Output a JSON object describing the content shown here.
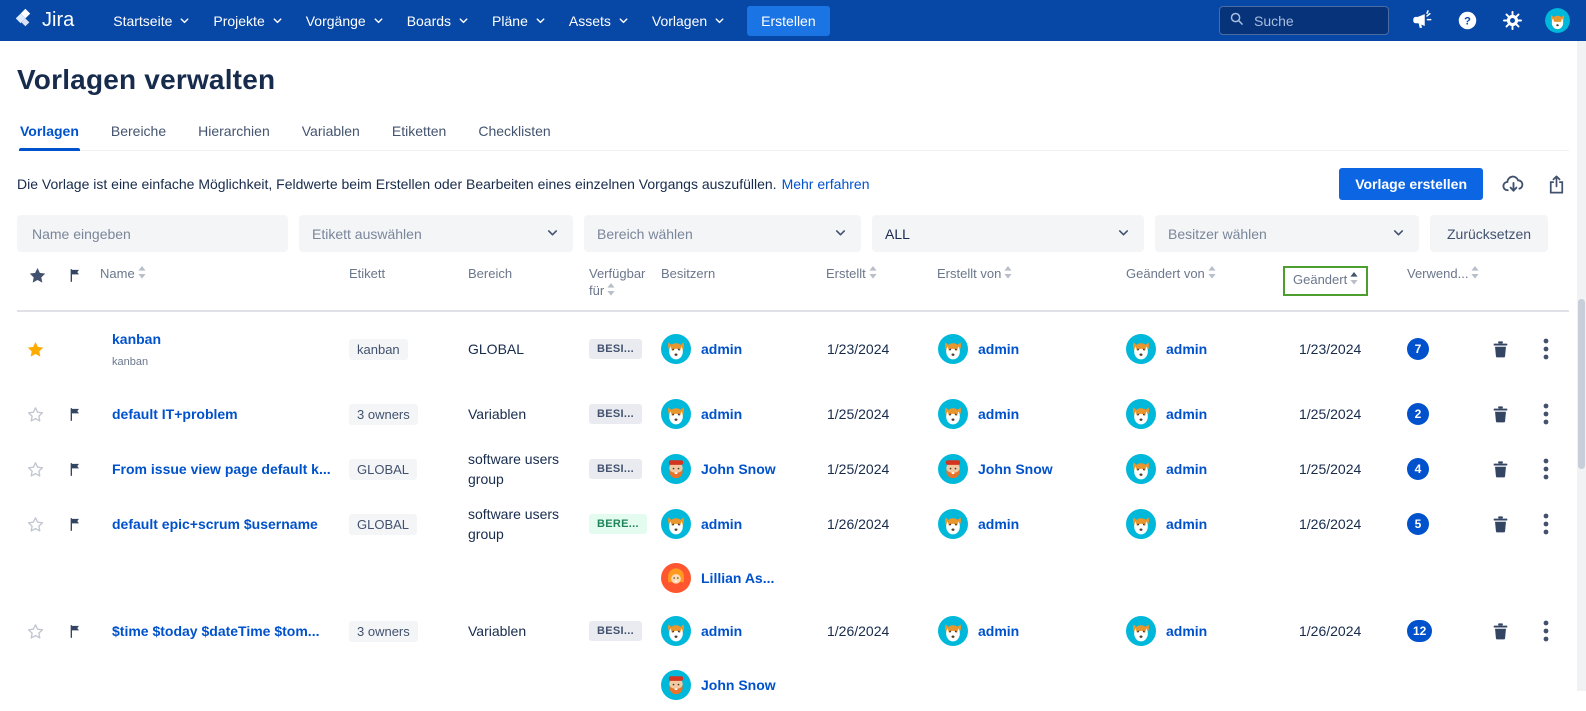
{
  "navbar": {
    "logo_text": "Jira",
    "items": [
      "Startseite",
      "Projekte",
      "Vorgänge",
      "Boards",
      "Pläne",
      "Assets",
      "Vorlagen"
    ],
    "create_label": "Erstellen",
    "search_placeholder": "Suche"
  },
  "page": {
    "title": "Vorlagen verwalten"
  },
  "tabs": {
    "items": [
      "Vorlagen",
      "Bereiche",
      "Hierarchien",
      "Variablen",
      "Etiketten",
      "Checklisten"
    ],
    "active": "Vorlagen"
  },
  "intro": {
    "text": "Die Vorlage ist eine einfache Möglichkeit, Feldwerte beim Erstellen oder Bearbeiten eines einzelnen Vorgangs auszufüllen.",
    "link_label": "Mehr erfahren"
  },
  "toolbar": {
    "create_label": "Vorlage erstellen"
  },
  "filters": {
    "name_placeholder": "Name eingeben",
    "label_placeholder": "Etikett auswählen",
    "scope_placeholder": "Bereich wählen",
    "type_value": "ALL",
    "owner_placeholder": "Besitzer wählen",
    "reset_label": "Zurücksetzen"
  },
  "table": {
    "headers": {
      "name": "Name",
      "label": "Etikett",
      "scope": "Bereich",
      "available_for": "Verfügbar für",
      "owners": "Besitzern",
      "created": "Erstellt",
      "created_by": "Erstellt von",
      "modified_by": "Geändert von",
      "modified": "Geändert",
      "usage": "Verwend..."
    },
    "sort": {
      "column": "Geändert",
      "direction": "asc",
      "highlight_color": "#4C9F2F"
    },
    "rows": [
      {
        "starred": true,
        "flagged": false,
        "name": "kanban",
        "subtitle": "kanban",
        "label": "kanban",
        "scope": "GLOBAL",
        "availability": {
          "text": "BESI...",
          "variant": "gray"
        },
        "owners": [
          {
            "name": "admin",
            "avatar": "dog"
          }
        ],
        "created": "1/23/2024",
        "created_by": {
          "name": "admin",
          "avatar": "dog"
        },
        "modified_by": {
          "name": "admin",
          "avatar": "dog"
        },
        "modified": "1/23/2024",
        "usage": "7"
      },
      {
        "starred": false,
        "flagged": true,
        "name": "default IT+problem",
        "subtitle": "",
        "label": "3 owners",
        "scope": "Variablen",
        "availability": {
          "text": "BESI...",
          "variant": "gray"
        },
        "owners": [
          {
            "name": "admin",
            "avatar": "dog"
          }
        ],
        "created": "1/25/2024",
        "created_by": {
          "name": "admin",
          "avatar": "dog"
        },
        "modified_by": {
          "name": "admin",
          "avatar": "dog"
        },
        "modified": "1/25/2024",
        "usage": "2"
      },
      {
        "starred": false,
        "flagged": true,
        "name": "From issue view page default k...",
        "subtitle": "",
        "label": "GLOBAL",
        "scope": "software users group",
        "availability": {
          "text": "BESI...",
          "variant": "gray"
        },
        "owners": [
          {
            "name": "John Snow",
            "avatar": "man"
          }
        ],
        "created": "1/25/2024",
        "created_by": {
          "name": "John Snow",
          "avatar": "man"
        },
        "modified_by": {
          "name": "admin",
          "avatar": "dog"
        },
        "modified": "1/25/2024",
        "usage": "4"
      },
      {
        "starred": false,
        "flagged": true,
        "name": "default epic+scrum $username",
        "subtitle": "",
        "label": "GLOBAL",
        "scope": "software users group",
        "availability": {
          "text": "BERE...",
          "variant": "green"
        },
        "owners": [
          {
            "name": "admin",
            "avatar": "dog"
          },
          {
            "name": "Lillian As...",
            "avatar": "woman"
          }
        ],
        "created": "1/26/2024",
        "created_by": {
          "name": "admin",
          "avatar": "dog"
        },
        "modified_by": {
          "name": "admin",
          "avatar": "dog"
        },
        "modified": "1/26/2024",
        "usage": "5"
      },
      {
        "starred": false,
        "flagged": true,
        "name": "$time $today $dateTime $tom...",
        "subtitle": "",
        "label": "3 owners",
        "scope": "Variablen",
        "availability": {
          "text": "BESI...",
          "variant": "gray"
        },
        "owners": [
          {
            "name": "admin",
            "avatar": "dog"
          },
          {
            "name": "John Snow",
            "avatar": "man"
          }
        ],
        "created": "1/26/2024",
        "created_by": {
          "name": "admin",
          "avatar": "dog"
        },
        "modified_by": {
          "name": "admin",
          "avatar": "dog"
        },
        "modified": "1/26/2024",
        "usage": "12"
      }
    ]
  },
  "colors": {
    "navbar": "#0747A6",
    "accent": "#0052CC",
    "highlight_green": "#4C9F2F",
    "star": "#FFAB00",
    "count_badge": "#0052CC",
    "badge_green_bg": "#E3FCEF",
    "badge_green_text": "#1F845A",
    "avatar_teal": "#00B8D9",
    "avatar_red": "#FF5630"
  }
}
